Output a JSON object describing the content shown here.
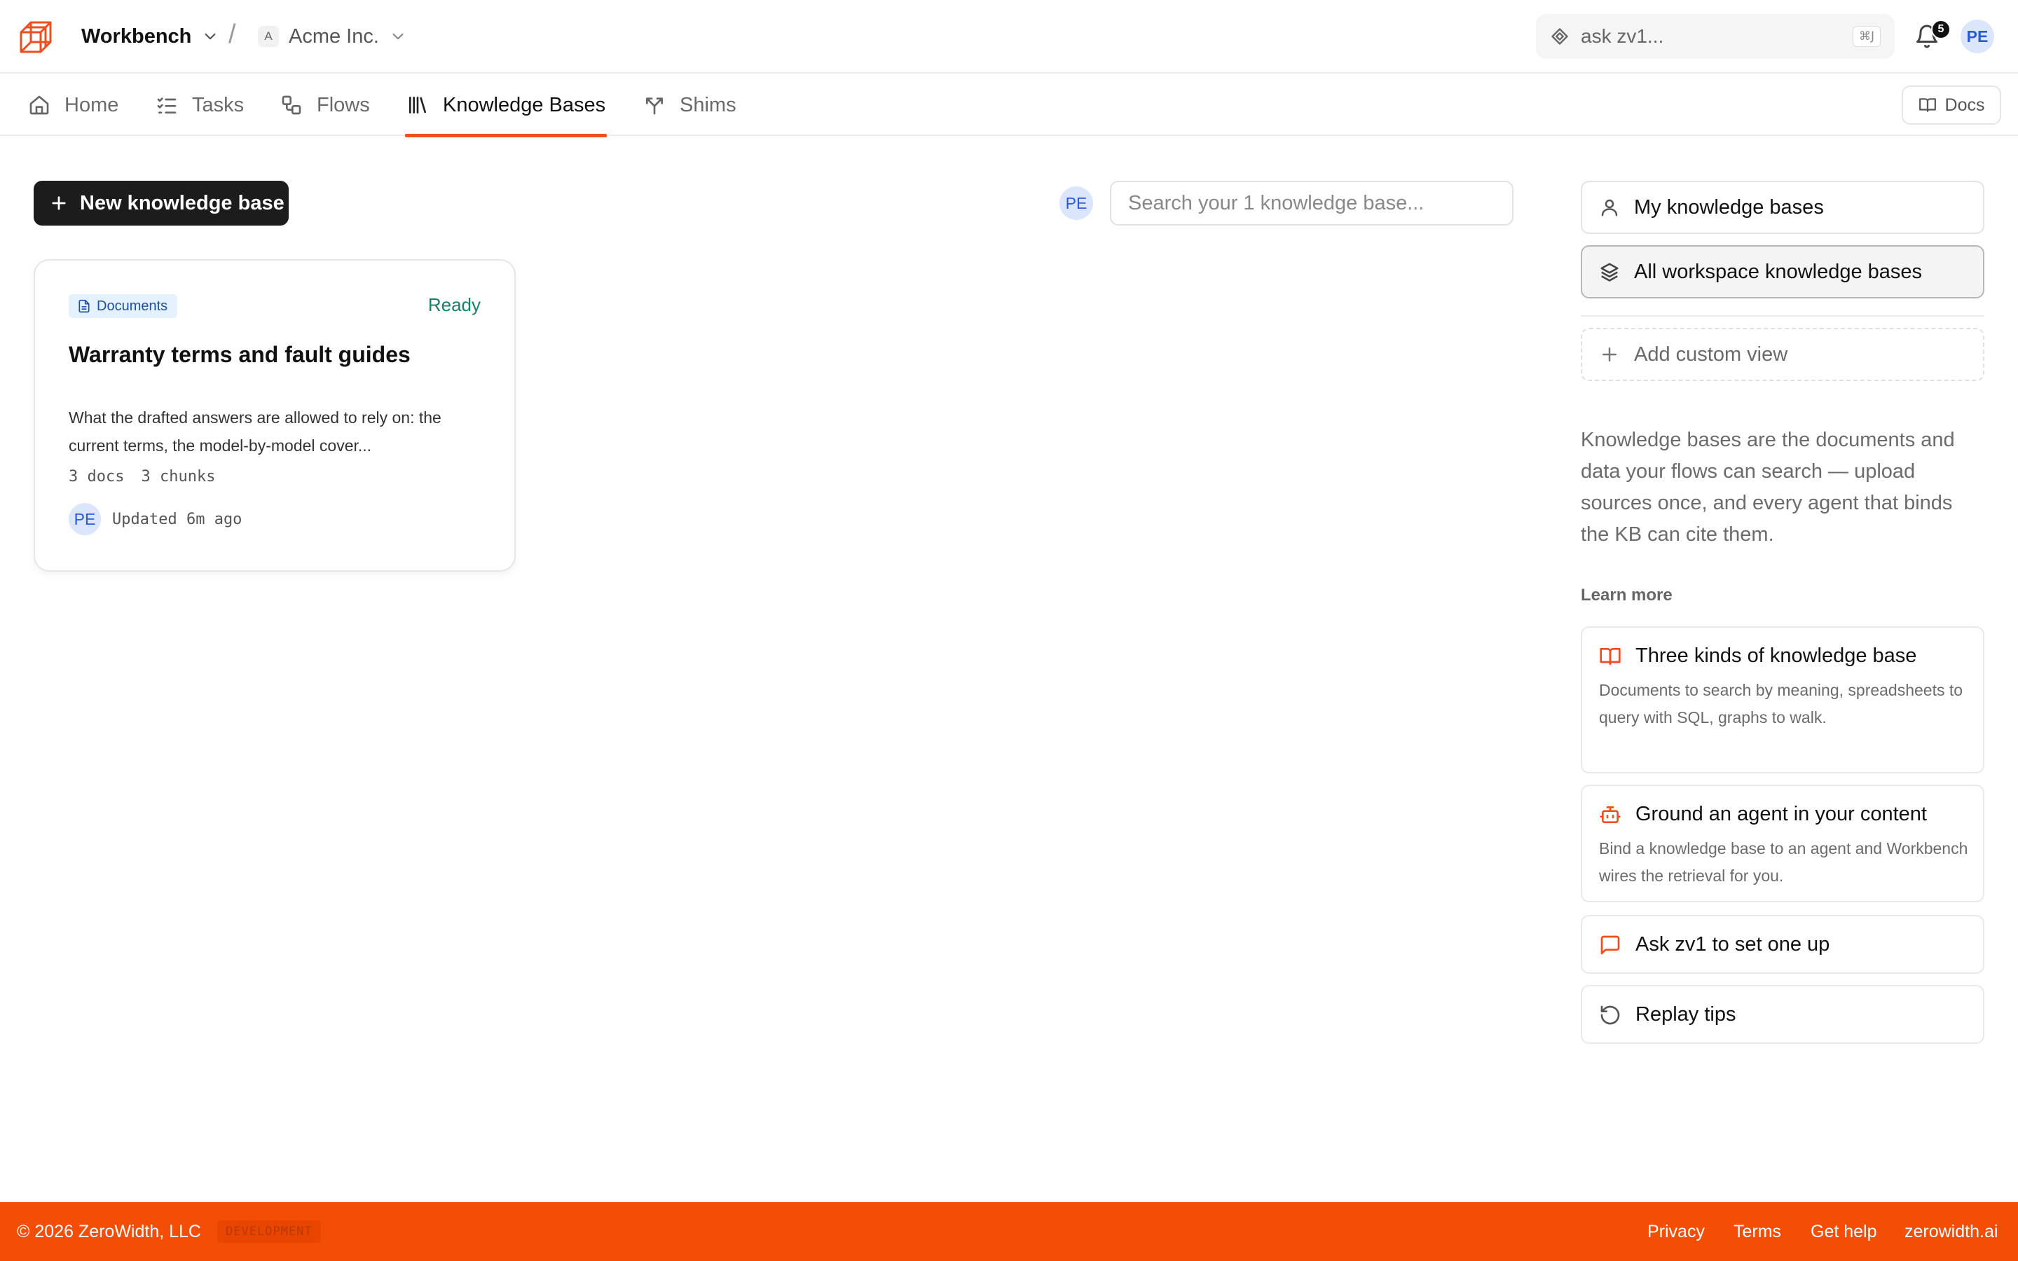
{
  "header": {
    "workspace": "Workbench",
    "separator": "/",
    "org_initial": "A",
    "org_name": "Acme Inc.",
    "ask_placeholder": "ask zv1...",
    "ask_shortcut": "⌘J",
    "notification_count": "5",
    "user_initials": "PE"
  },
  "nav": {
    "tabs": [
      {
        "label": "Home",
        "icon": "home-icon"
      },
      {
        "label": "Tasks",
        "icon": "tasks-icon"
      },
      {
        "label": "Flows",
        "icon": "flows-icon"
      },
      {
        "label": "Knowledge Bases",
        "icon": "library-icon",
        "active": true
      },
      {
        "label": "Shims",
        "icon": "fork-icon"
      }
    ],
    "docs_label": "Docs"
  },
  "main": {
    "new_button": "New knowledge base",
    "owner_filter_initials": "PE",
    "search_placeholder": "Search your 1 knowledge base...",
    "cards": [
      {
        "type_label": "Documents",
        "status": "Ready",
        "title": "Warranty terms and fault guides",
        "description": "What the drafted answers are allowed to rely on: the current terms, the model-by-model cover...",
        "docs": "3 docs",
        "chunks": "3 chunks",
        "owner_initials": "PE",
        "updated": "Updated 6m ago"
      }
    ]
  },
  "sidebar": {
    "views": [
      {
        "label": "My knowledge bases",
        "icon": "user-icon"
      },
      {
        "label": "All workspace knowledge bases",
        "icon": "layers-icon",
        "selected": true
      }
    ],
    "add_view": "Add custom view",
    "info": "Knowledge bases are the documents and data your flows can search — upload sources once, and every agent that binds the KB can cite them.",
    "learn_more": "Learn more",
    "learn_cards": [
      {
        "title": "Three kinds of knowledge base",
        "description": "Documents to search by meaning, spreadsheets to query with SQL, graphs to walk.",
        "icon": "book-open-icon"
      },
      {
        "title": "Ground an agent in your content",
        "description": "Bind a knowledge base to an agent and Workbench wires the retrieval for you.",
        "icon": "bot-icon"
      },
      {
        "title": "Ask zv1 to set one up",
        "icon": "message-icon"
      },
      {
        "title": "Replay tips",
        "icon": "replay-icon"
      }
    ]
  },
  "footer": {
    "copyright": "© 2026 ZeroWidth, LLC",
    "env": "DEVELOPMENT",
    "links": [
      "Privacy",
      "Terms",
      "Get help",
      "zerowidth.ai"
    ]
  },
  "colors": {
    "accent": "#f04e1c",
    "footer": "#f34d06",
    "status_ready": "#1a8066",
    "avatar_bg": "#dbe5fb",
    "avatar_text": "#2a5bd7"
  }
}
